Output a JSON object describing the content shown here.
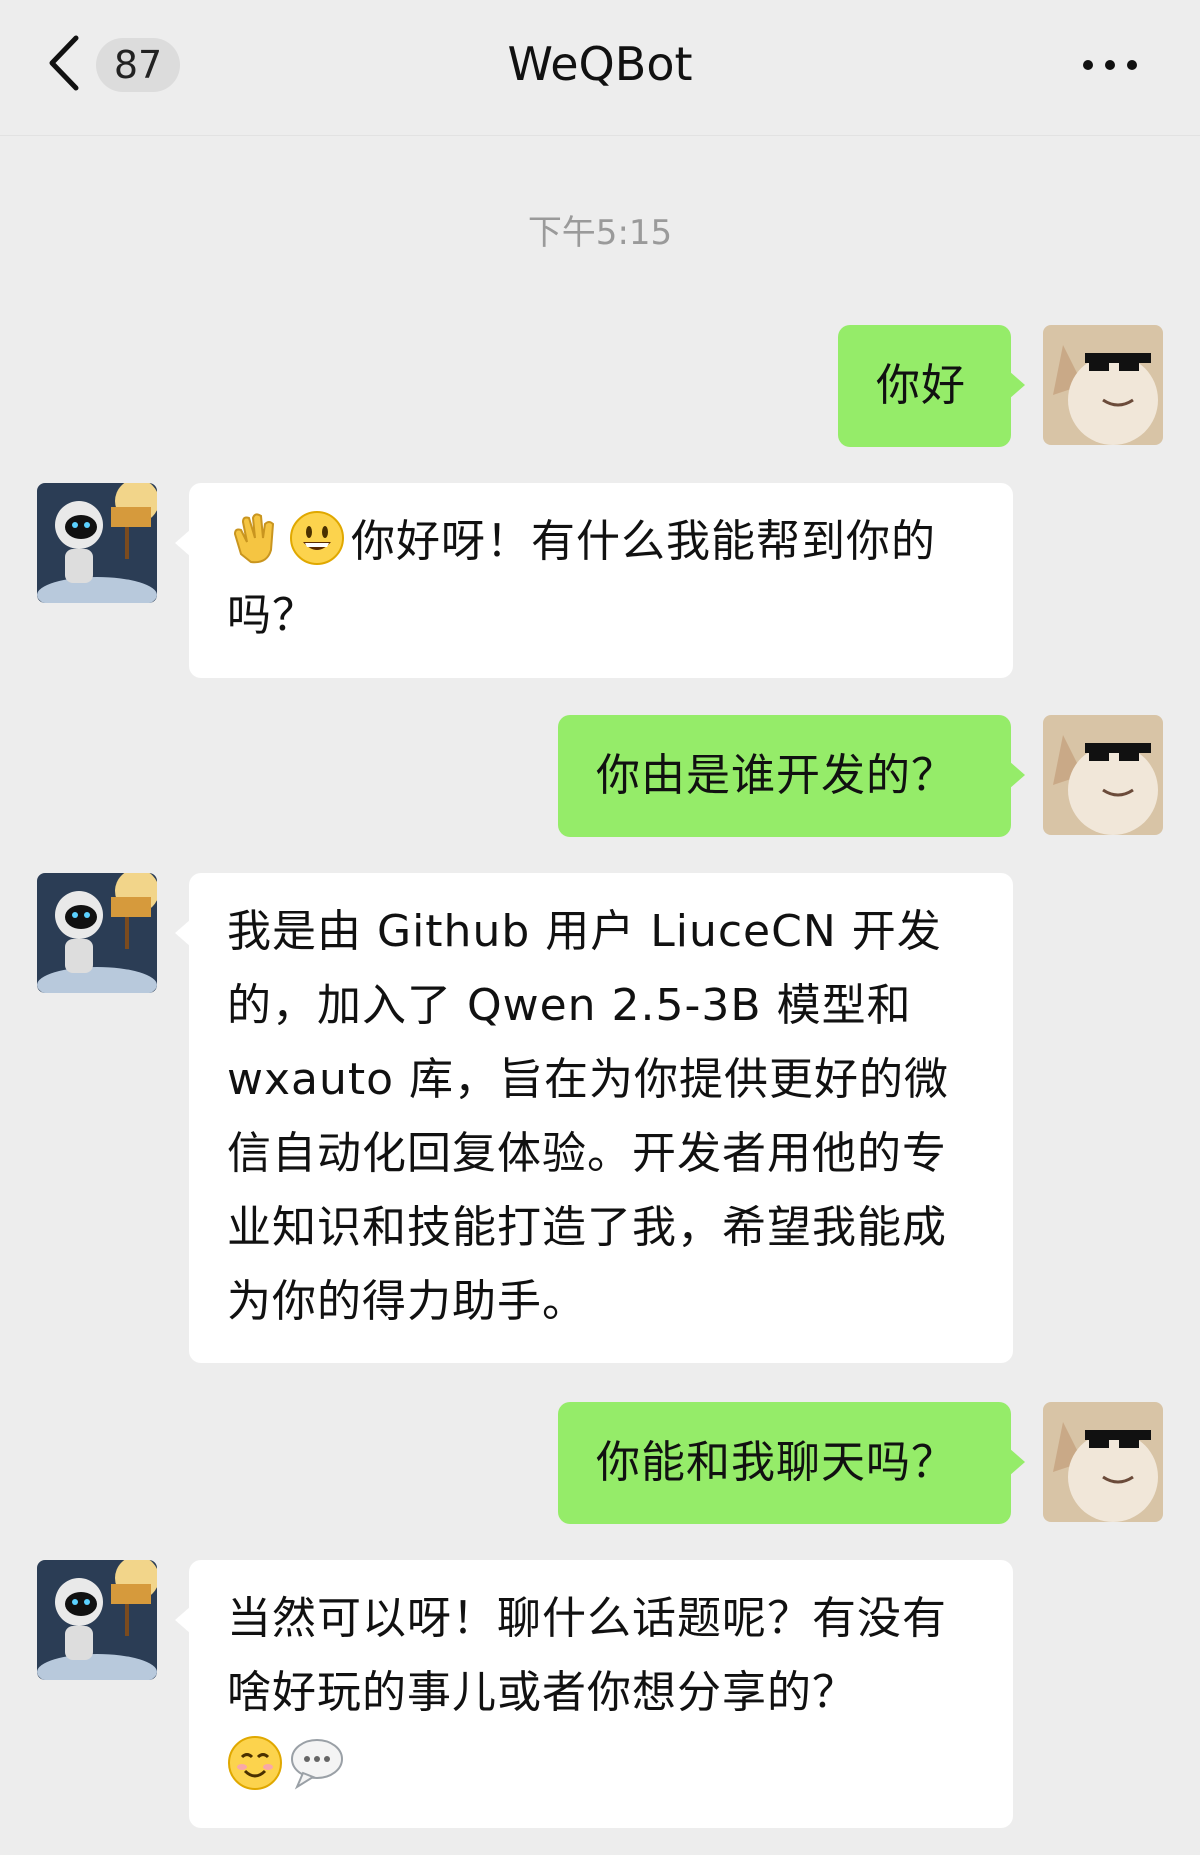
{
  "header": {
    "title": "WeQBot",
    "unread_count": "87"
  },
  "timestamp": "下午5:15",
  "messages": [
    {
      "sender": "me",
      "text": "你好"
    },
    {
      "sender": "bot",
      "emoji": [
        "waving-hand",
        "grinning-face"
      ],
      "text": "你好呀！有什么我能帮到你的吗？"
    },
    {
      "sender": "me",
      "text": "你由是谁开发的？"
    },
    {
      "sender": "bot",
      "text": "我是由 Github 用户 LiuceCN 开发的，加入了 Qwen 2.5-3B 模型和 wxauto 库，旨在为你提供更好的微信自动化回复体验。开发者用他的专业知识和技能打造了我，希望我能成为你的得力助手。"
    },
    {
      "sender": "me",
      "text": "你能和我聊天吗？"
    },
    {
      "sender": "bot",
      "text": "当然可以呀！聊什么话题呢？有没有啥好玩的事儿或者你想分享的？",
      "emoji": [
        "smiling-face",
        "speech-bubble"
      ]
    }
  ],
  "colors": {
    "background": "#ededed",
    "my_bubble": "#95ec69",
    "bot_bubble": "#ffffff"
  }
}
